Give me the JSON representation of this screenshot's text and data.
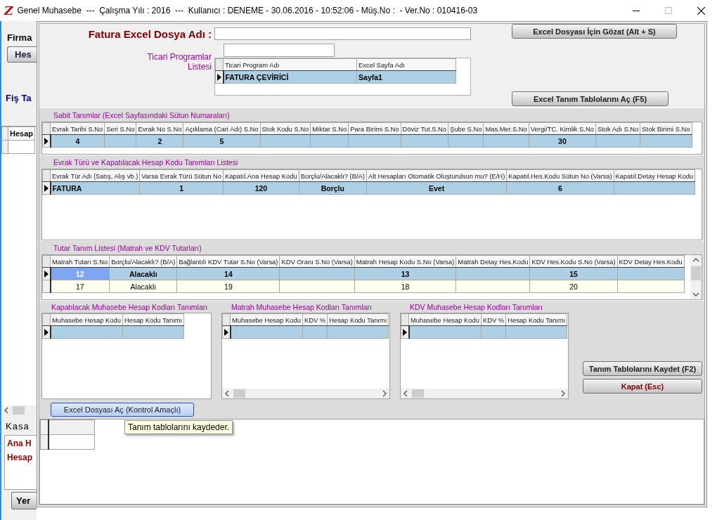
{
  "window": {
    "logo": "Z",
    "title": "Genel Muhasebe  ---  Çalışma Yılı : 2016  ---  Kullanıcı : DENEME - 30.06.2016 - 10:52:06 - Müş.No :  - Ver.No : 010416-03"
  },
  "background_window": {
    "firm_label": "Firma",
    "button": "Hes",
    "link": "Fiş Ta",
    "grid_header": "Hesap",
    "group_label": "Kasa",
    "panel_lines": [
      "Ana H",
      "Hesap"
    ],
    "bottom_button": "Yer"
  },
  "dialog": {
    "file_label": "Fatura Excel Dosya Adı :",
    "browse_button": "Excel Dosyası İçin Gözat (Alt + S)",
    "programs_label": "Ticari Programlar Listesi",
    "programs_grid": {
      "columns": [
        "Ticari Program Adı",
        "Excel Sayfa Adı"
      ],
      "rows": [
        {
          "selected": true,
          "cells": [
            "FATURA ÇEVİRİCİ",
            "Sayfa1"
          ]
        }
      ]
    },
    "open_tables_button": "Excel Tanım Tablolarını Aç (F5)",
    "fixed_definitions": {
      "title": "Sabit Tanımlar (Excel Sayfasındaki Sütun Numaraları)",
      "columns": [
        "Evrak Tarihi S.No",
        "Seri S.No",
        "Evrak No S.No",
        "Açıklama (Cari Adı) S.No",
        "Stok Kodu S.No",
        "Miktar S.No",
        "Para Birimi S.No",
        "Döviz Tut.S.No",
        "Şube S.No",
        "Mas.Mer.S.No",
        "Vergi/TC. Kimlik S.No",
        "Stok Adı S.No",
        "Stok Birimi S.No"
      ],
      "rows": [
        {
          "selected": true,
          "cells": [
            "4",
            null,
            "2",
            "5",
            null,
            null,
            null,
            null,
            null,
            null,
            "30",
            null,
            null
          ]
        }
      ]
    },
    "document_types": {
      "title": "Evrak Türü ve Kapatılacak Hesap Kodu Tanımları Listesi",
      "columns": [
        "Evrak Tür Adı (Satış, Alış vb.)",
        "Varsa Evrak Türü Sütun No",
        "Kapatıl.Ana Hesap Kodu",
        "Borçlu/Alacaklı? (B/A)",
        "Alt Hesapları Otomatik Oluşturulsun mu? (E/H)",
        "Kapatıl.Hes.Kodu Sütun No (Varsa)",
        "Kapatıl.Detay Hesap Kodu"
      ],
      "rows": [
        {
          "selected": true,
          "cells": [
            "FATURA",
            "1",
            "120",
            "Borçlu",
            "Evet",
            "6",
            null
          ]
        }
      ]
    },
    "amounts": {
      "title": "Tutar Tanım Listesi (Matrah ve KDV Tutarları)",
      "columns": [
        "Matrah Tutarı S.No",
        "Borçlu/Alacaklı? (B/A)",
        "Bağlantılı KDV Tutar S.No (Varsa)",
        "KDV Oranı S.No (Varsa)",
        "Matrah Hesap Kodu S.No (Varsa)",
        "Matrah Detay Hes.Kodu",
        "KDV Hes.Kodu S.No (Varsa)",
        "KDV Detay Hes.Kodu"
      ],
      "rows": [
        {
          "selected": true,
          "cells": [
            {
              "text": "12",
              "focused": true
            },
            {
              "text": "Alacaklı",
              "focused": false
            },
            {
              "text": "14",
              "focused": false
            },
            {
              "focused": false
            },
            {
              "text": "13",
              "focused": false
            },
            {
              "focused": false
            },
            {
              "text": "15",
              "focused": false
            },
            {
              "focused": false
            }
          ]
        },
        {
          "selected": false,
          "cells": [
            {
              "text": "17",
              "focused": false
            },
            {
              "text": "Alacaklı",
              "focused": false
            },
            {
              "text": "19",
              "focused": false
            },
            {
              "focused": false
            },
            {
              "text": "18",
              "focused": false
            },
            {
              "focused": false
            },
            {
              "text": "20",
              "focused": false
            },
            {
              "focused": false
            }
          ]
        }
      ]
    },
    "account_panels": [
      {
        "title": "Kapatılacak Muhasebe Hesap Kodları Tanımları",
        "columns": [
          "Muhasebe Hesap Kodu",
          "Hesap Kodu Tanımı"
        ],
        "rows": [
          {
            "selected": true
          }
        ]
      },
      {
        "title": "Matrah Muhasebe Hesap Kodları Tanımları",
        "columns": [
          "Muhasebe Hesap Kodu",
          "KDV %",
          "Hesap Kodu Tanımı"
        ],
        "rows": [
          {
            "selected": true
          }
        ]
      },
      {
        "title": "KDV Muhasebe Hesap Kodları Tanımları",
        "columns": [
          "Muhasebe Hesap Kodu",
          "KDV %",
          "Hesap Kodu Tanımı"
        ],
        "rows": [
          {
            "selected": true
          }
        ]
      }
    ],
    "save_button": "Tanım Tablolarını Kaydet (F2)",
    "close_button": "Kapat (Esc)",
    "open_excel_button": "Excel Dosyası Aç (Kontrol Amaçlı)",
    "tooltip": "Tanım tablolarını kaydeder."
  }
}
